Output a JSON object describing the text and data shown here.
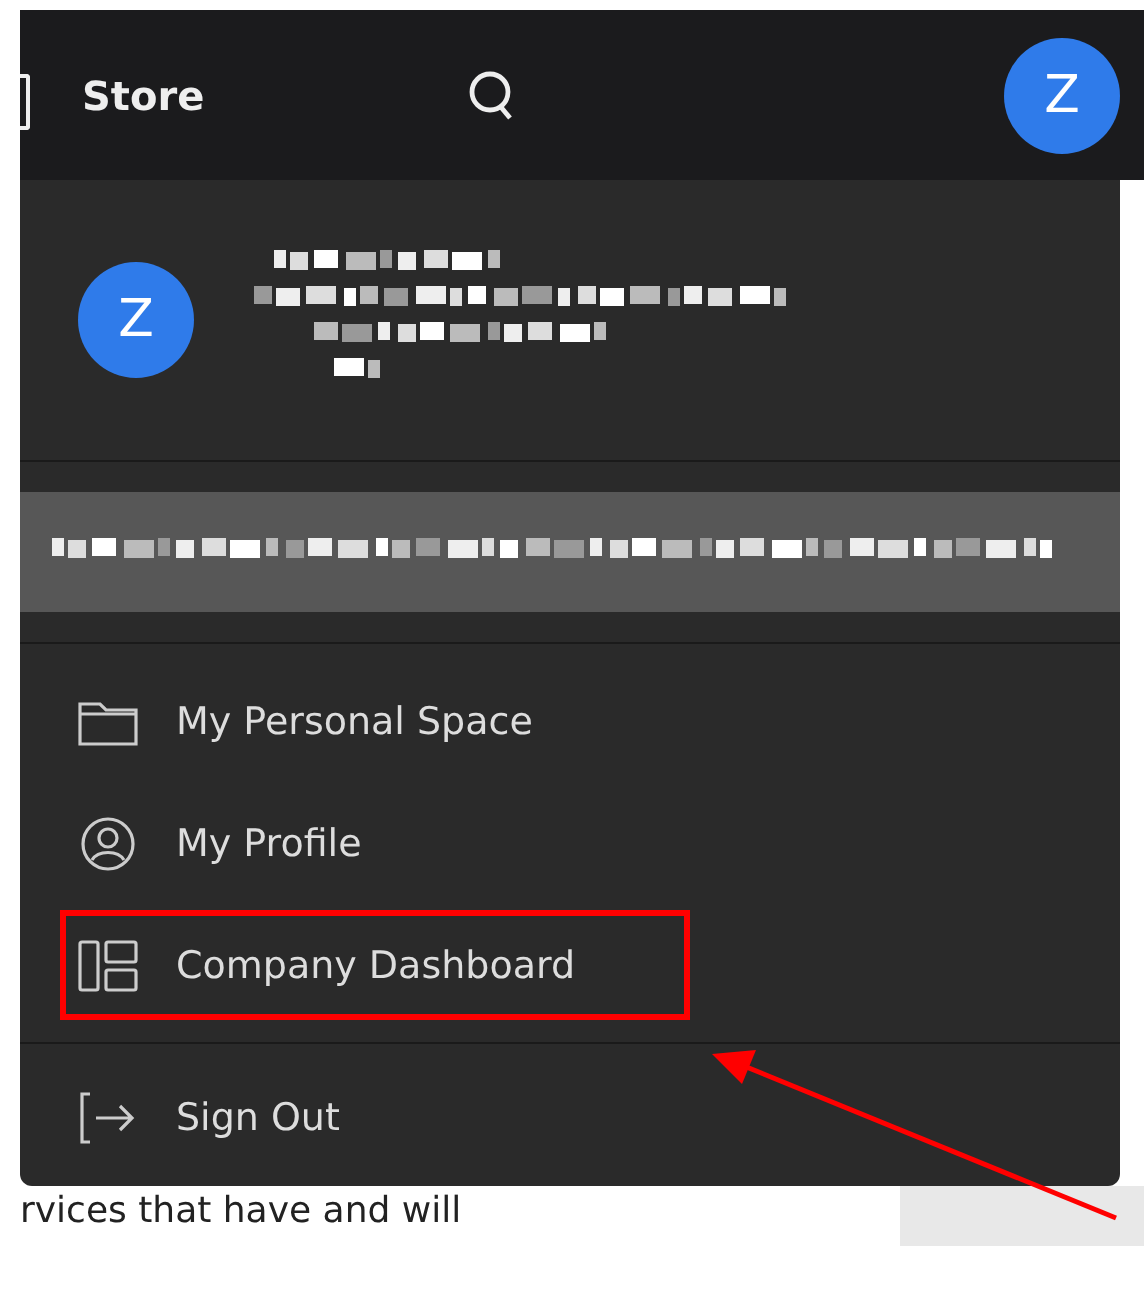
{
  "top_bar": {
    "title": "Store",
    "avatar_initial": "Z"
  },
  "menu": {
    "avatar_initial": "Z",
    "items": [
      {
        "kind": "folder",
        "label": "My Personal Space",
        "highlighted": false
      },
      {
        "kind": "profile",
        "label": "My Profile",
        "highlighted": false
      },
      {
        "kind": "dashboard",
        "label": "Company Dashboard",
        "highlighted": true
      }
    ],
    "sign_out": {
      "kind": "signout",
      "label": "Sign Out"
    }
  },
  "background_text": "rvices that have and will"
}
